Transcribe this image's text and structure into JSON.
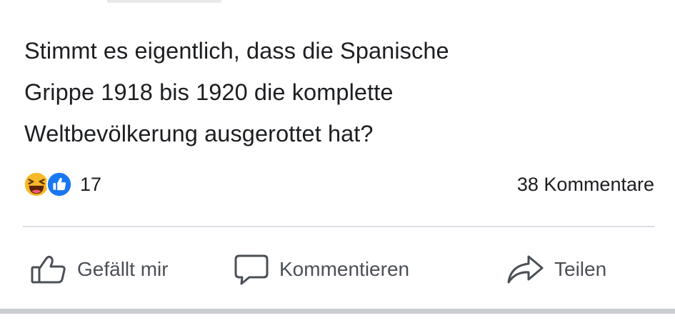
{
  "post": {
    "text_lines": [
      "Stimmt es eigentlich, dass die Spanische",
      "Grippe 1918 bis 1920 die komplette",
      "Weltbevölkerung ausgerottet hat?"
    ]
  },
  "stats": {
    "reaction_icons": [
      "haha-icon",
      "like-icon"
    ],
    "reaction_count": "17",
    "comments": "38 Kommentare"
  },
  "actions": {
    "like_label": "Gefällt mir",
    "comment_label": "Kommentieren",
    "share_label": "Teilen"
  },
  "colors": {
    "text": "#1c1e21",
    "action_text": "#4b4f56",
    "like_blue": "#1877f2",
    "haha_yellow": "#f7b928",
    "divider": "#dadde1"
  }
}
